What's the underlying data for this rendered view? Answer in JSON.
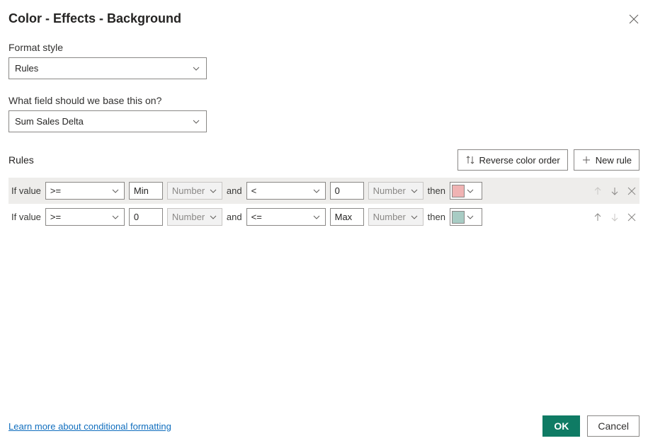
{
  "dialog": {
    "title": "Color - Effects - Background"
  },
  "format_style": {
    "label": "Format style",
    "value": "Rules"
  },
  "field": {
    "label": "What field should we base this on?",
    "value": "Sum Sales Delta"
  },
  "rules": {
    "label": "Rules",
    "reverse_label": "Reverse color order",
    "new_rule_label": "New rule",
    "items": [
      {
        "if_label": "If value",
        "op1": ">=",
        "val1": "Min",
        "type1": "Number",
        "and_label": "and",
        "op2": "<",
        "val2": "0",
        "type2": "Number",
        "then_label": "then",
        "color": "#f0b3b3",
        "selected": true
      },
      {
        "if_label": "If value",
        "op1": ">=",
        "val1": "0",
        "type1": "Number",
        "and_label": "and",
        "op2": "<=",
        "val2": "Max",
        "type2": "Number",
        "then_label": "then",
        "color": "#a8ccc4",
        "selected": false
      }
    ]
  },
  "footer": {
    "learn_more": "Learn more about conditional formatting",
    "ok": "OK",
    "cancel": "Cancel"
  }
}
